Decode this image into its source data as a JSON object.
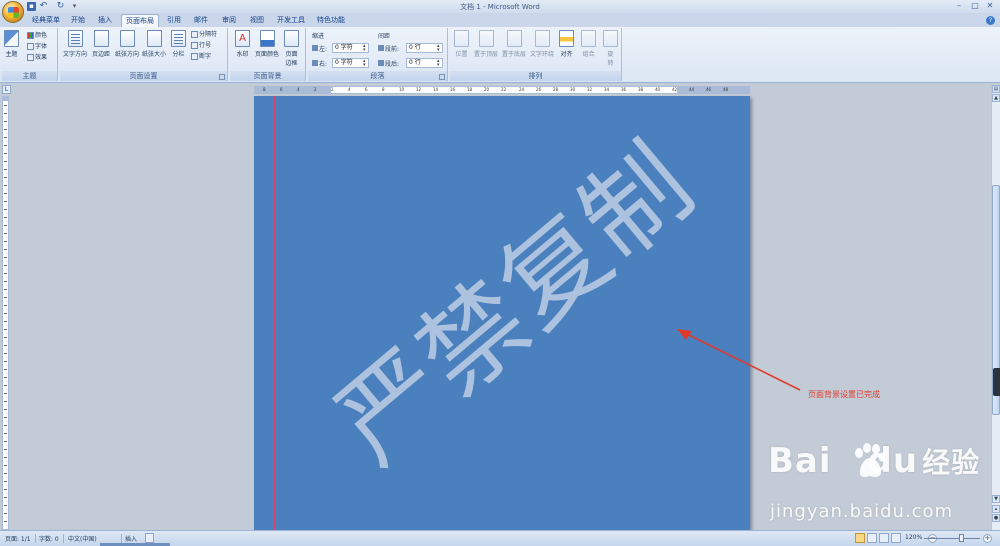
{
  "title_bar": {
    "app_title": "文档 1 - Microsoft Word",
    "quick_access": {
      "save": "▪",
      "undo": "↶",
      "redo": "↻",
      "more": "▾"
    },
    "window_buttons": {
      "minimize": "–",
      "maximize": "□",
      "close": "✕"
    }
  },
  "tabs": [
    {
      "label": "经典菜单"
    },
    {
      "label": "开始"
    },
    {
      "label": "插入"
    },
    {
      "label": "页面布局"
    },
    {
      "label": "引用"
    },
    {
      "label": "邮件"
    },
    {
      "label": "审阅"
    },
    {
      "label": "视图"
    },
    {
      "label": "开发工具"
    },
    {
      "label": "特色功能"
    }
  ],
  "active_tab": "页面布局",
  "ribbon": {
    "theme_group": {
      "label": "主题",
      "theme": "主题",
      "colors": "颜色",
      "fonts": "字体",
      "effects": "效果"
    },
    "page_setup_group": {
      "label": "页面设置",
      "text_direction": "文字方向",
      "margins": "页边距",
      "orientation": "纸张方向",
      "size": "纸张大小",
      "columns": "分栏",
      "breaks": "分隔符",
      "line_numbers": "行号",
      "hyphenation": "断字"
    },
    "page_background_group": {
      "label": "页面背景",
      "watermark": "水印",
      "page_color": "页面颜色",
      "page_border_1": "页面",
      "page_border_2": "边框"
    },
    "paragraph_group": {
      "label": "段落",
      "indent": "缩进",
      "left": "左:",
      "right": "右:",
      "left_value": "0 字符",
      "right_value": "0 字符",
      "spacing": "间距",
      "before": "段前:",
      "after": "段后:",
      "before_value": "0 行",
      "after_value": "0 行"
    },
    "arrange_group": {
      "label": "排列",
      "position": "位置",
      "bring_front": "置于顶层",
      "send_back": "置于底层",
      "text_wrap": "文字环绕",
      "align": "对齐",
      "group": "组合",
      "rotate_1": "旋",
      "rotate_2": "转"
    }
  },
  "ruler": {
    "corner": "L",
    "labels": [
      "8",
      "6",
      "4",
      "2",
      "2",
      "4",
      "6",
      "8",
      "10",
      "12",
      "14",
      "16",
      "18",
      "20",
      "22",
      "24",
      "26",
      "28",
      "30",
      "32",
      "34",
      "36",
      "38",
      "40",
      "42",
      "44",
      "46",
      "48"
    ]
  },
  "document": {
    "watermark_text": "严禁复制",
    "page_color": "#4a80bd",
    "margin_line_color": "#d2456e"
  },
  "annotation": {
    "text": "页面背景设置已完成",
    "color": "#e23a2a"
  },
  "baidu_watermark": {
    "logo_left": "Bai",
    "logo_right": "du",
    "logo_cn": "经验",
    "url": "jingyan.baidu.com"
  },
  "status_bar": {
    "page": "页面: 1/1",
    "words": "字数: 0",
    "language": "中文(中国)",
    "mode": "插入",
    "zoom": "120%"
  }
}
